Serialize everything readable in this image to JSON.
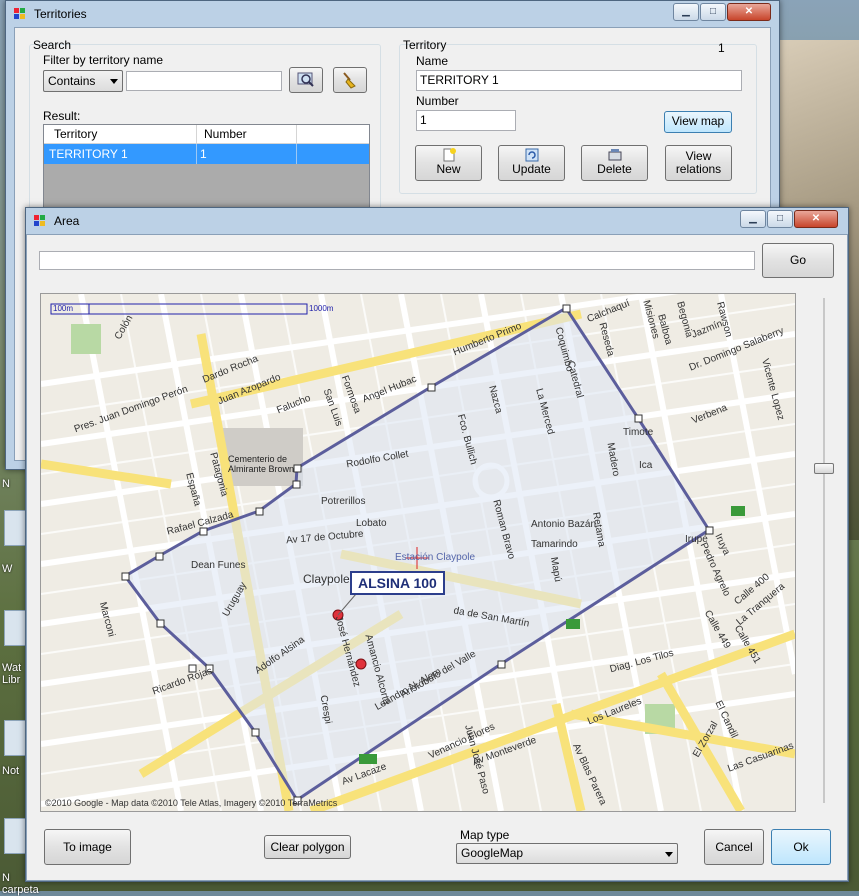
{
  "desktop": {
    "icons": [
      {
        "label": "N"
      },
      {
        "label": "W"
      },
      {
        "label": "Wat Libr"
      },
      {
        "label": "Not"
      },
      {
        "label": "N carpeta"
      }
    ]
  },
  "territories": {
    "title": "Territories",
    "search": {
      "group_label": "Search",
      "filter_label": "Filter by territory name",
      "filter_mode": "Contains",
      "filter_value": ""
    },
    "result": {
      "label": "Result:",
      "columns": [
        "Territory",
        "Number"
      ],
      "rows": [
        {
          "territory": "TERRITORY 1",
          "number": "1"
        }
      ]
    },
    "territory": {
      "group_label": "Territory",
      "counter": "1",
      "name_label": "Name",
      "name_value": "TERRITORY 1",
      "number_label": "Number",
      "number_value": "1",
      "view_map": "View map"
    },
    "buttons": {
      "new": "New",
      "update": "Update",
      "delete": "Delete",
      "view_relations": "View relations"
    }
  },
  "area": {
    "title": "Area",
    "address_value": "",
    "go": "Go",
    "map": {
      "marker_label": "ALSINA 100",
      "scale_small": "100m",
      "scale_large": "1000m",
      "copyright": "©2010 Google - Map data ©2010 Tele Atlas, Imagery ©2010 TerraMetrics",
      "streets": [
        "Humberto Primo",
        "Pres. Juan Domingo Perón",
        "Dardo Rocha",
        "Juan Azopardo",
        "Falucho",
        "San Luis",
        "Formosa",
        "Angel Hubac",
        "Fco. Bullich",
        "Nazca",
        "Coquimbo",
        "Roman Bravo",
        "La Merced",
        "Catedral",
        "Reseda",
        "Timote",
        "Calchaquí",
        "Misiones",
        "Balboa",
        "Begonia",
        "Jazmín",
        "Rawson",
        "Dr. Domingo Salaberry",
        "Vicente Lopez",
        "Verbena",
        "Lobato",
        "Potrerillos",
        "Rafael Calzada",
        "Av 17 de Octubre",
        "Claypole",
        "Estación Claypole",
        "da de San Martín",
        "Adolfo Alsina",
        "José Hernández",
        "Amancio Alcorta",
        "Leandro N. Alem",
        "Aristóbulo del Valle",
        "Av Lacaze",
        "Av Monteverde",
        "Av Blas Parera",
        "Los Laureles",
        "El Zorzal",
        "Las Casuarinas",
        "Diag. Los Tilos",
        "El Candil",
        "Uruguay",
        "Dean Funes",
        "Ricardo Rojas",
        "Marconi",
        "Colón",
        "Patagonia",
        "España",
        "Cementerio de Almirante Brown",
        "Venancio Flores",
        "Juan José Paso",
        "Iruya",
        "Pedro Agrelo",
        "Calle 400",
        "La Tranquera",
        "Calle 449",
        "Calle 451",
        "Rodolfo Collet",
        "Antonio Bazán",
        "Tamarindo",
        "Retama",
        "Madero",
        "Ica",
        "Irupé",
        "Mapú",
        "Crespi"
      ]
    },
    "buttons": {
      "to_image": "To image",
      "clear_polygon": "Clear polygon",
      "cancel": "Cancel",
      "ok": "Ok"
    },
    "map_type": {
      "label": "Map type",
      "selected": "GoogleMap"
    }
  }
}
